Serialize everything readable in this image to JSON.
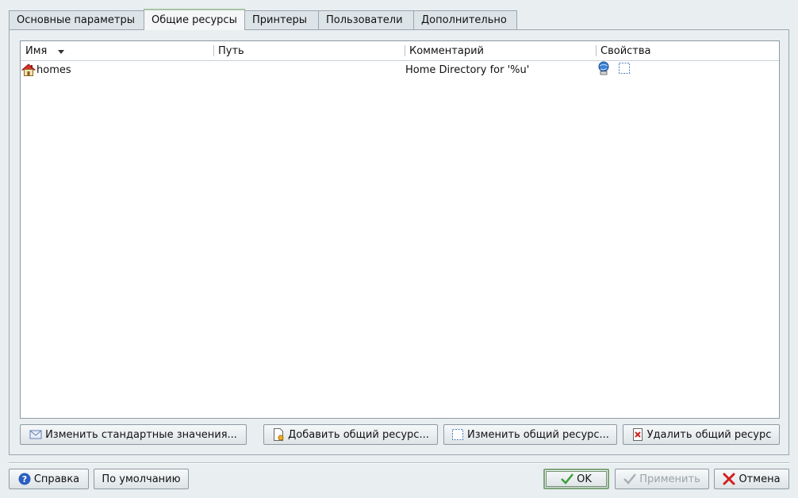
{
  "tabs": [
    {
      "label": "Основные параметры"
    },
    {
      "label": "Общие ресурсы"
    },
    {
      "label": "Принтеры"
    },
    {
      "label": "Пользователи"
    },
    {
      "label": "Дополнительно"
    }
  ],
  "table": {
    "headers": {
      "name": "Имя",
      "path": "Путь",
      "comment": "Комментарий",
      "props": "Свойства"
    },
    "rows": [
      {
        "name": "homes",
        "path": "",
        "comment": "Home Directory for '%u'",
        "icon": "house-icon",
        "props_icons": [
          "globe-printer-icon",
          "share-dotted-icon"
        ]
      }
    ]
  },
  "actions": {
    "edit_defaults": "Изменить стандартные значения...",
    "add_share": "Добавить общий ресурс...",
    "edit_share": "Изменить общий ресурс...",
    "delete_share": "Удалить общий ресурс"
  },
  "footer": {
    "help": "Справка",
    "defaults": "По умолчанию",
    "ok": "OK",
    "apply": "Применить",
    "cancel": "Отмена"
  },
  "colors": {
    "accent_tab": "#a8c4a2",
    "ok_icon": "#3aa03a",
    "cancel_icon": "#d02020"
  }
}
